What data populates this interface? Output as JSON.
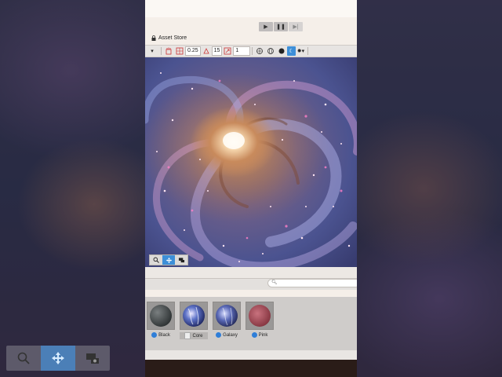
{
  "playbar": {
    "play_icon": "play-icon",
    "pause_icon": "pause-icon",
    "step_icon": "step-icon",
    "play_glyph": "▶",
    "pause_glyph": "❚❚",
    "step_glyph": "▶|"
  },
  "asset_store": {
    "label": "Asset Store",
    "icon": "lock-icon"
  },
  "toolbar": {
    "value_a": "0.25",
    "value_b": "15",
    "value_c": "1"
  },
  "scene_tools": {
    "items": [
      "search-icon",
      "move-icon",
      "camera-icon"
    ],
    "active_index": 1
  },
  "search": {
    "placeholder": ""
  },
  "assets": [
    {
      "name": "Black",
      "badge": "blue-dot"
    },
    {
      "name": "Core",
      "badge": "document"
    },
    {
      "name": "Galaxy",
      "badge": "blue-dot"
    },
    {
      "name": "Pink",
      "badge": "blue-dot"
    }
  ],
  "colors": {
    "accent": "#3d8fd8",
    "panel_bg": "#f5efe9",
    "asset_area_bg": "#cfccca"
  }
}
